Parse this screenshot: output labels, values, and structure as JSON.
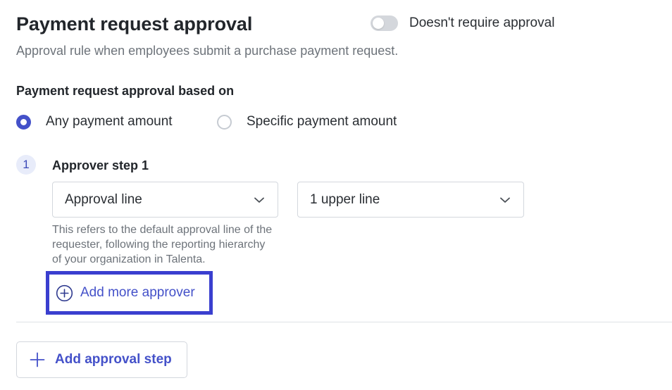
{
  "header": {
    "title": "Payment request approval",
    "toggle_label": "Doesn't require approval",
    "toggle_on": false,
    "subtitle": "Approval rule when employees submit a purchase payment request."
  },
  "basis": {
    "label": "Payment request approval based on",
    "options": [
      {
        "label": "Any payment amount",
        "selected": true
      },
      {
        "label": "Specific payment amount",
        "selected": false
      }
    ]
  },
  "steps": [
    {
      "number": "1",
      "title": "Approver step 1",
      "approver_type": "Approval line",
      "approver_level": "1 upper line",
      "helper": "This refers to the default approval line of the requester, following the reporting hierarchy of your organization in Talenta.",
      "add_more_label": "Add more approver"
    }
  ],
  "add_step_label": "Add approval step",
  "colors": {
    "accent": "#4451c9",
    "highlight_border": "#3a3fcf",
    "toggle_off": "#d4d7dc",
    "badge_bg": "#e8ecfa"
  },
  "icons": [
    "chevron-down-icon",
    "plus-circle-icon",
    "plus-icon"
  ]
}
